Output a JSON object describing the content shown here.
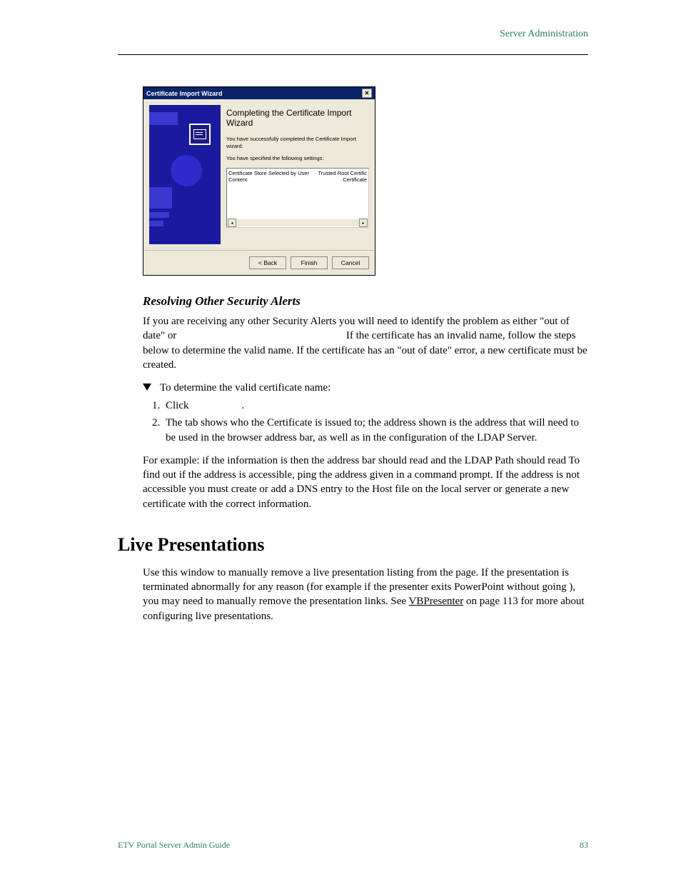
{
  "header": {
    "right": "Server Administration"
  },
  "dialog": {
    "title": "Certificate Import Wizard",
    "heading": "Completing the Certificate Import Wizard",
    "msg1": "You have successfully completed the Certificate Import wizard.",
    "msg2": "You have specified the following settings:",
    "rows": [
      {
        "k": "Certificate Store Selected by User",
        "v": "Trusted Root Certific"
      },
      {
        "k": "Content",
        "v": "Certificate"
      }
    ],
    "buttons": {
      "back": "< Back",
      "finish": "Finish",
      "cancel": "Cancel"
    }
  },
  "subheading": "Resolving Other Security Alerts",
  "para1a": "If you are receiving any other Security Alerts you will need to identify the problem as either \"out of date\" or ",
  "para1b": " If the certificate has an invalid name, follow the steps below to determine the valid name. If the certificate has an \"out of date\" error, a new certificate must be created.",
  "procTitle": "To determine the valid certificate name:",
  "step1a": "Click ",
  "step1b": ".",
  "step2": "The             tab shows who the Certificate is issued to; the address shown is the address that will need to be used in the browser address bar, as well as in the configuration of the LDAP Server.",
  "example": "For example: if the information is                               then the address bar should read                                     and the LDAP Path should read                                                  To find out if the address is accessible, ping the address given in a command prompt. If the address is not accessible you must create or add a DNS entry to the Host file on the local server or generate a new certificate with the correct information.",
  "section": "Live Presentations",
  "live1": "Use this window to manually remove a live presentation listing from the                      page. If the presentation is terminated abnormally for any reason (for example if the presenter exits PowerPoint without going             ), you may need to manually remove the presentation links. See ",
  "liveLink": "VBPresenter",
  "live2": " on page 113 for more about configuring live presentations.",
  "footer": {
    "left": "ETV Portal Server Admin Guide",
    "right": "83"
  }
}
